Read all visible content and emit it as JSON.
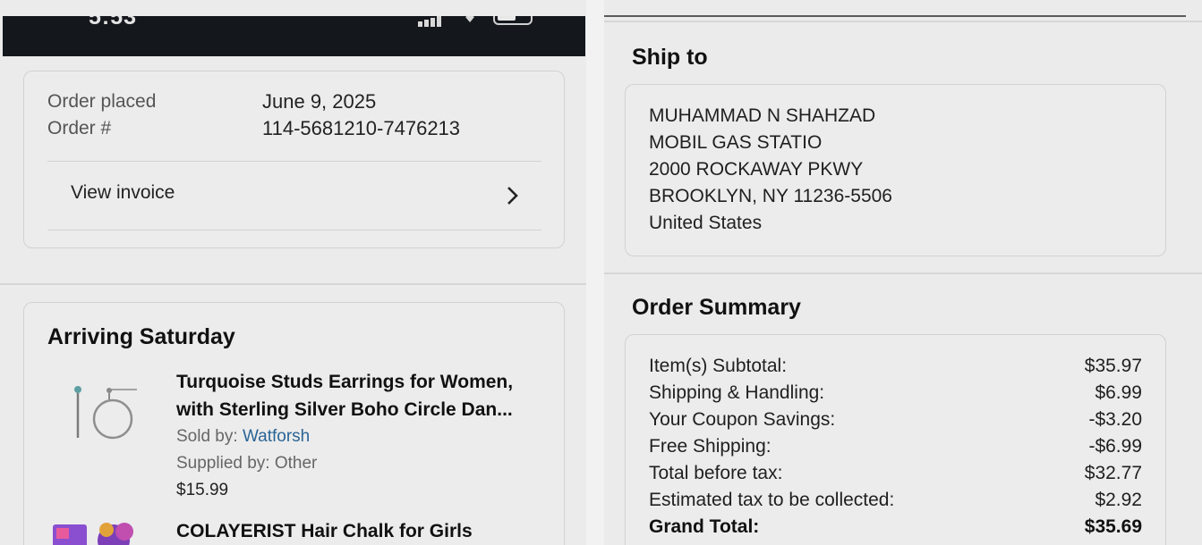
{
  "status_bar": {
    "time": "5:53"
  },
  "order": {
    "placed_label": "Order placed",
    "placed_value": "June 9, 2025",
    "number_label": "Order #",
    "number_value": "114-5681210-7476213",
    "invoice_label": "View invoice"
  },
  "shipment": {
    "title": "Arriving Saturday",
    "items": [
      {
        "title_line1": "Turquoise Studs Earrings for Women,",
        "title_line2": "with Sterling Silver Boho Circle Dan...",
        "sold_by_label": "Sold by: ",
        "sold_by_value": "Watforsh",
        "supplied_by": "Supplied by: Other",
        "price": "$15.99"
      },
      {
        "title_line1": "COLAYERIST Hair Chalk for Girls"
      }
    ]
  },
  "ship_to": {
    "title": "Ship to",
    "lines": [
      "MUHAMMAD N SHAHZAD",
      "MOBIL GAS STATIO",
      "2000 ROCKAWAY PKWY",
      "BROOKLYN, NY 11236-5506",
      "United States"
    ]
  },
  "summary": {
    "title": "Order Summary",
    "rows": [
      {
        "label": "Item(s) Subtotal:",
        "value": "$35.97"
      },
      {
        "label": "Shipping & Handling:",
        "value": "$6.99"
      },
      {
        "label": "Your Coupon Savings:",
        "value": "-$3.20"
      },
      {
        "label": "Free Shipping:",
        "value": "-$6.99"
      },
      {
        "label": "Total before tax:",
        "value": "$32.77"
      },
      {
        "label": "Estimated tax to be collected:",
        "value": "$2.92"
      },
      {
        "label": "Grand Total:",
        "value": "$35.69"
      }
    ]
  },
  "icons": {
    "invoice_arrow": "chevron-right-icon",
    "signal": "signal-icon",
    "wifi": "wifi-icon",
    "battery": "battery-icon"
  },
  "colors": {
    "link": "#2a6496",
    "status_bar": "#14181d",
    "background": "#ebebeb"
  }
}
